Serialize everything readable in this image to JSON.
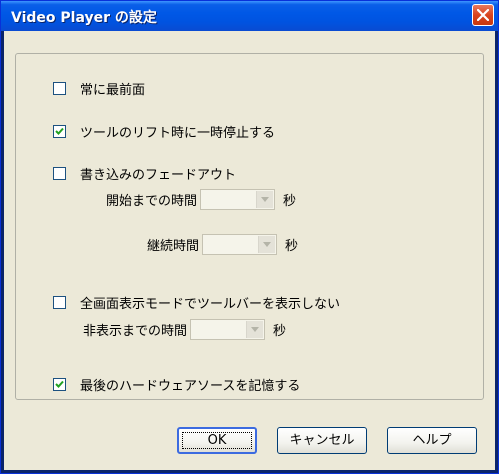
{
  "window": {
    "title": "Video Player の設定"
  },
  "options": {
    "always_on_top": {
      "label": "常に最前面",
      "checked": false
    },
    "pause_on_tool_lift": {
      "label": "ツールのリフト時に一時停止する",
      "checked": true
    },
    "fade_out": {
      "label": "書き込みのフェードアウト",
      "checked": false,
      "start_label": "開始までの時間",
      "start_value": "",
      "start_unit": "秒",
      "duration_label": "継続時間",
      "duration_value": "",
      "duration_unit": "秒"
    },
    "hide_toolbar": {
      "label": "全画面表示モードでツールバーを表示しない",
      "checked": false,
      "hide_label": "非表示までの時間",
      "hide_value": "",
      "hide_unit": "秒"
    },
    "remember_source": {
      "label": "最後のハードウェアソースを記憶する",
      "checked": true
    }
  },
  "buttons": {
    "ok": "OK",
    "cancel": "キャンセル",
    "help": "ヘルプ"
  },
  "icons": {
    "close": "close-icon",
    "checkmark": "checkmark-icon",
    "dropdown": "chevron-down-icon"
  },
  "colors": {
    "titlebar": "#0058e6",
    "close_button": "#d9441e",
    "dialog_bg": "#ece9d8",
    "default_button_border": "#3c6be0"
  }
}
